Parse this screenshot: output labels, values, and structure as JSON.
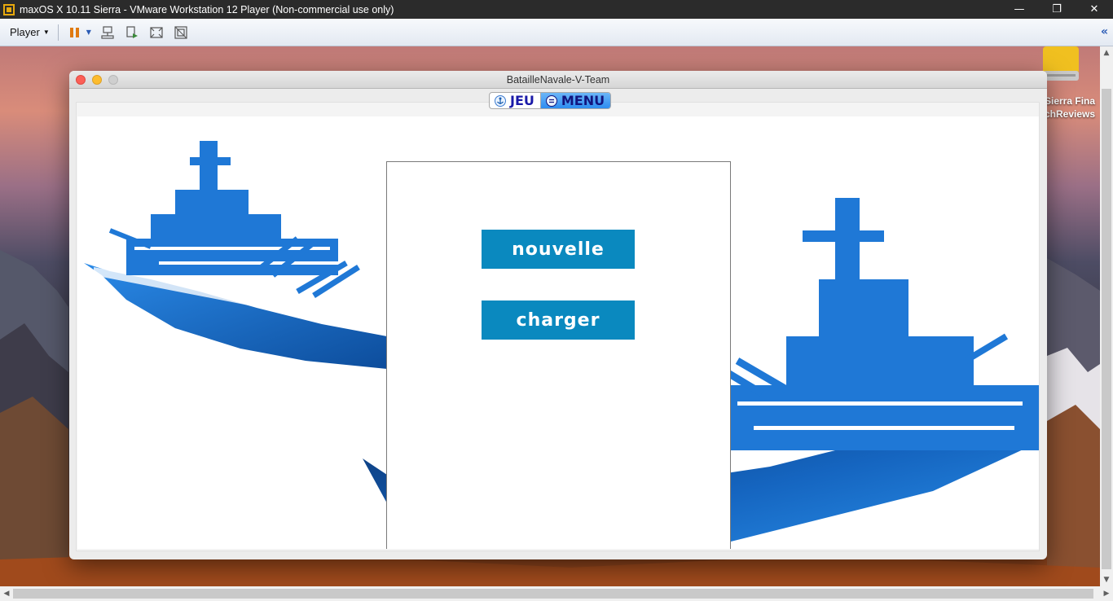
{
  "host": {
    "title": "maxOS X 10.11 Sierra - VMware Workstation 12 Player (Non-commercial use only)",
    "toolbar": {
      "player_label": "Player"
    }
  },
  "desktop": {
    "drive_label": "Sierra Fina\nchReviews"
  },
  "app": {
    "window_title": "BatailleNavale-V-Team",
    "tabs": [
      {
        "label": "JEU",
        "active": false
      },
      {
        "label": "MENU",
        "active": true
      }
    ],
    "menu": {
      "new_label": "nouvelle",
      "load_label": "charger"
    }
  },
  "colors": {
    "button_bg": "#0a89bf",
    "ship_blue": "#1a7fd8",
    "tab_active": "#2d8cf0"
  }
}
